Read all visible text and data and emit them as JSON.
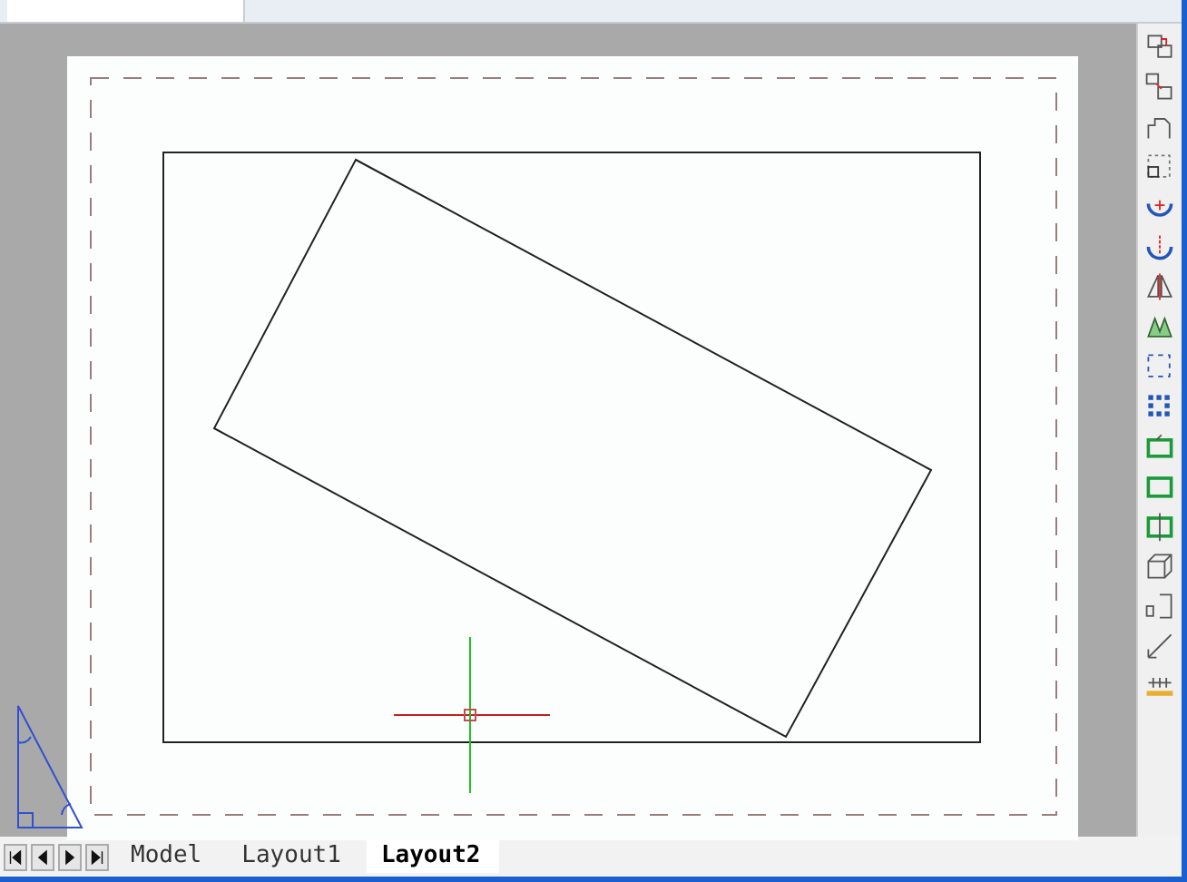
{
  "layout_tabs": [
    {
      "label": "Model",
      "selected": false
    },
    {
      "label": "Layout1",
      "selected": false
    },
    {
      "label": "Layout2",
      "selected": true
    }
  ]
}
